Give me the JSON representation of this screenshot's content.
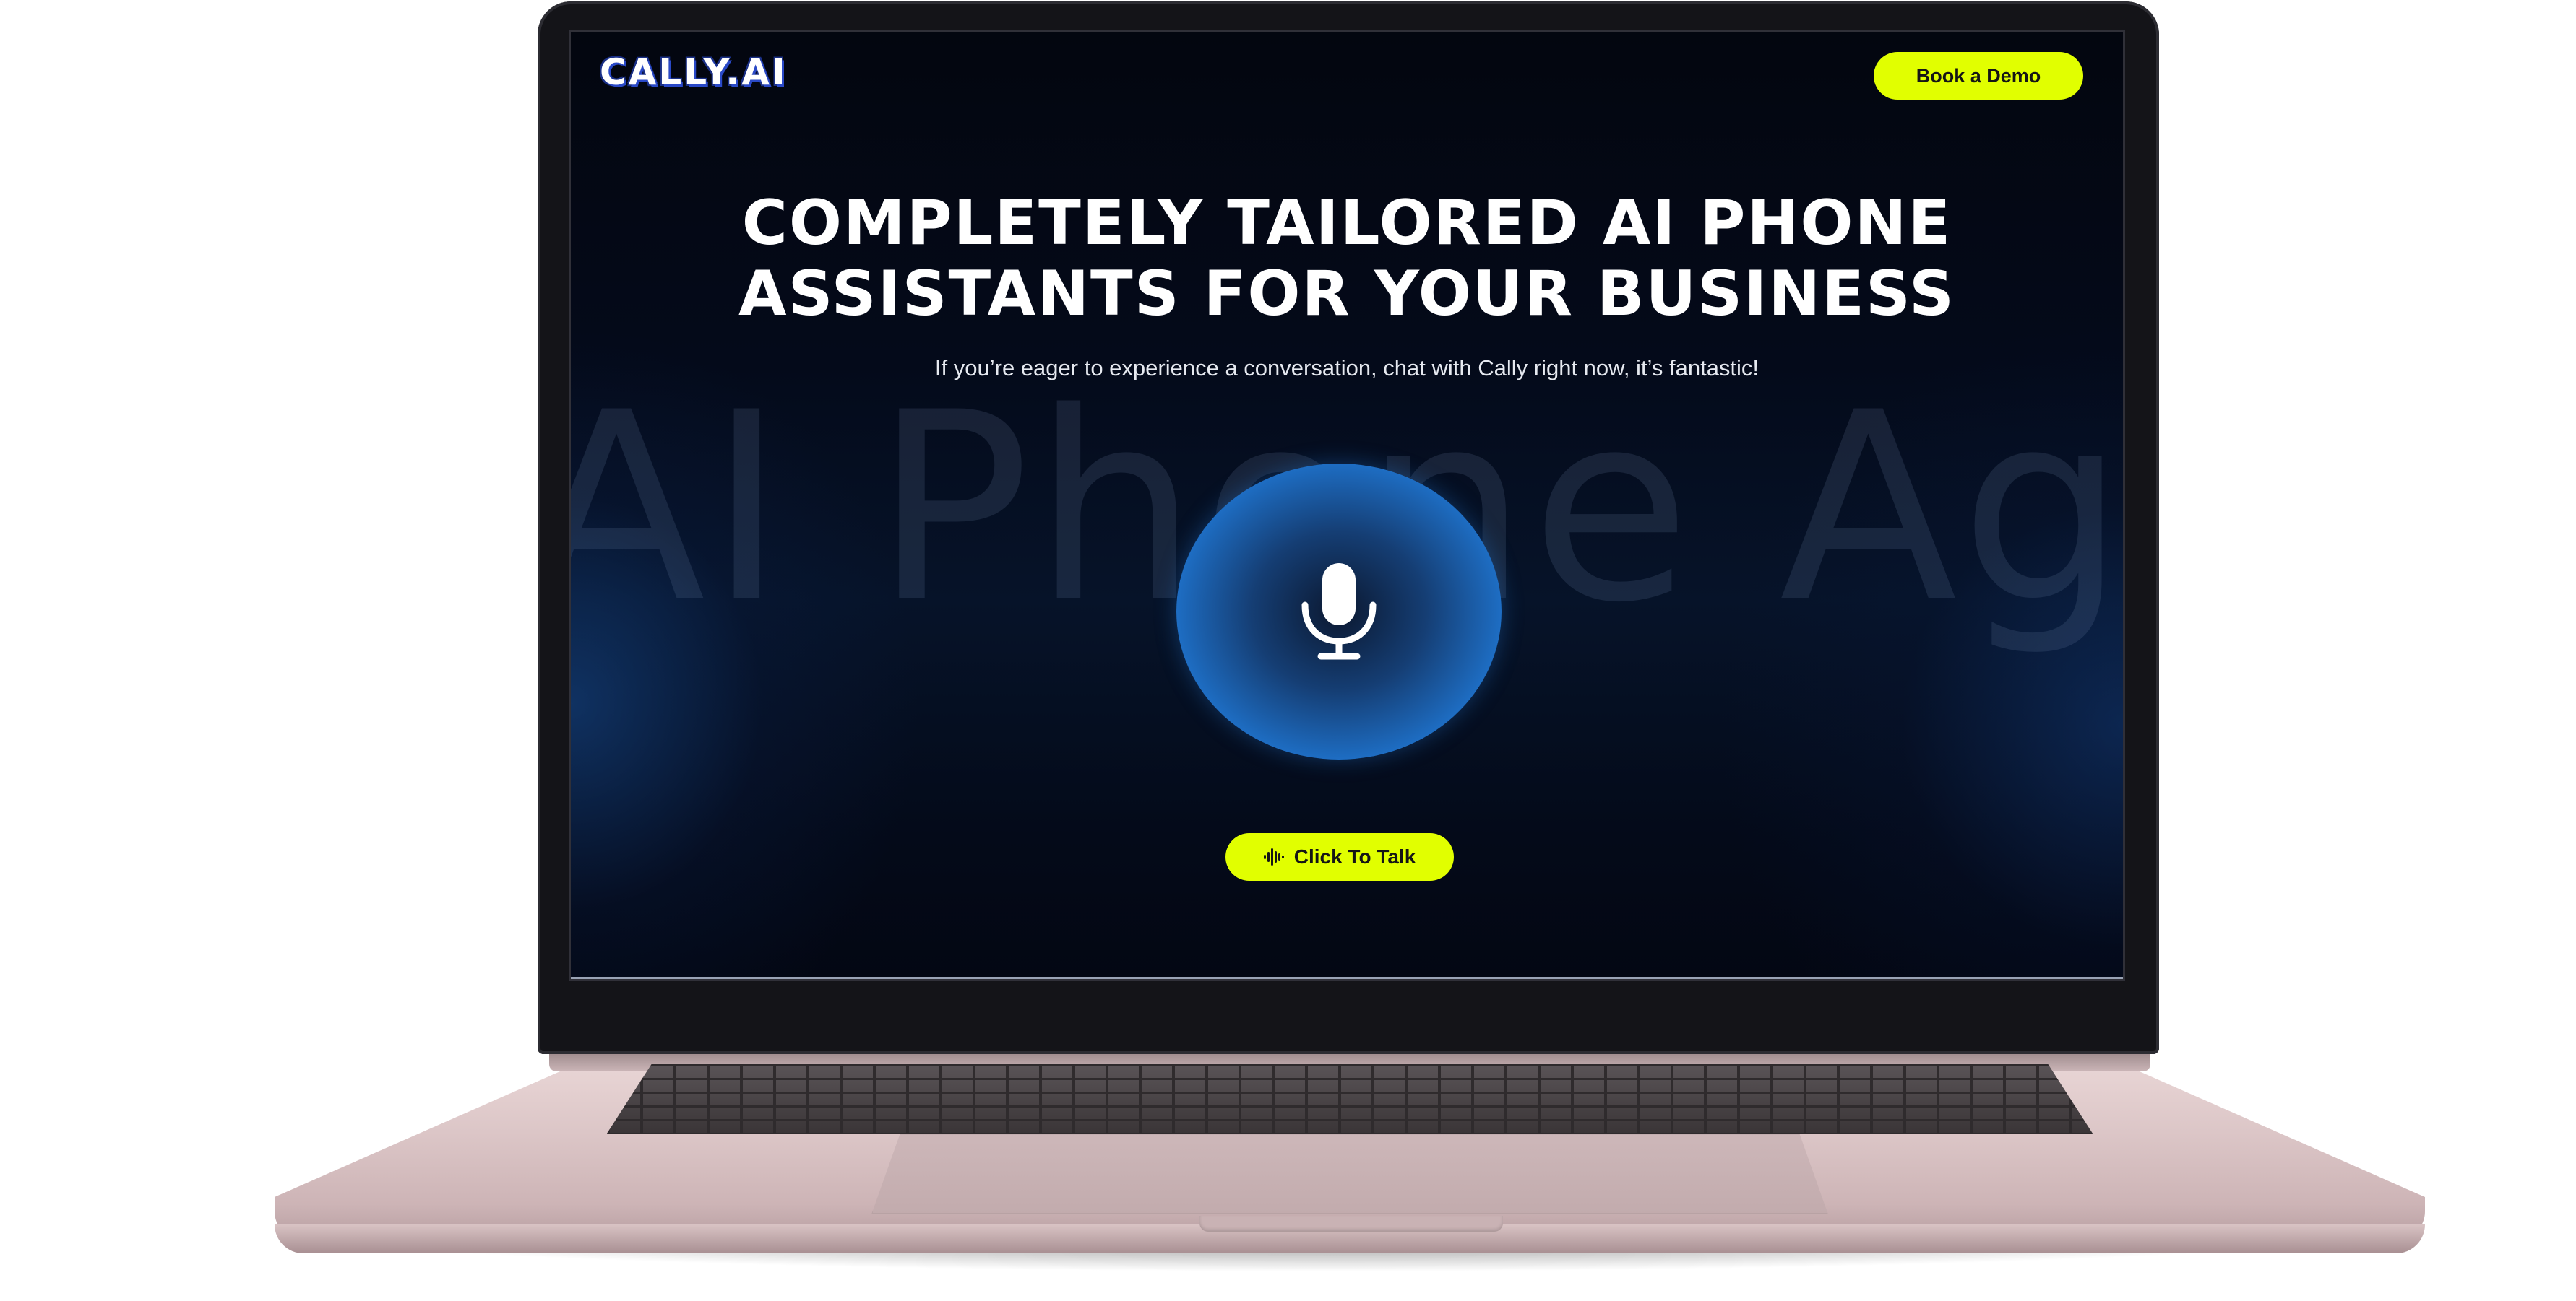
{
  "header": {
    "logo_text": "CALLY.AI",
    "demo_button_label": "Book a Demo"
  },
  "hero": {
    "headline_line1": "COMPLETELY TAILORED AI PHONE",
    "headline_line2": "ASSISTANTS FOR YOUR BUSINESS",
    "subtitle": "If you’re eager to experience a conversation, chat with Cally right now, it’s fantastic!",
    "background_text": "AI Phone Agent",
    "talk_button_label": "Click To Talk"
  },
  "icons": {
    "mic": "microphone-icon",
    "talk": "sound-wave-icon"
  },
  "colors": {
    "accent": "#e1ff00",
    "orb_blue": "#247fdd",
    "page_bg": "#040a1a"
  }
}
